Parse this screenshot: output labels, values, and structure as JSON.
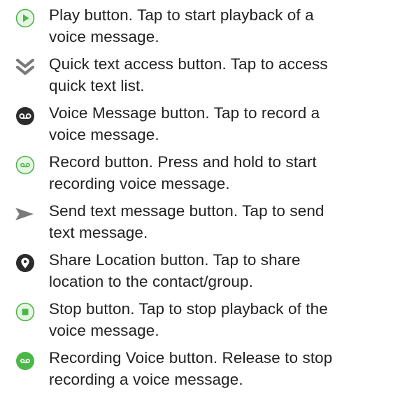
{
  "colors": {
    "accent_green": "#4ab847",
    "light_green_fill": "#e6f5e4",
    "dark_icon": "#2b2b2b",
    "gray_icon": "#7a7a7a",
    "text": "#222222"
  },
  "items": [
    {
      "icon": "play-icon",
      "line1": "Play button. Tap to start playback of a",
      "line2": "voice message."
    },
    {
      "icon": "double-chevron-down-icon",
      "line1": "Quick text access button. Tap to access",
      "line2": "quick text list."
    },
    {
      "icon": "voicemail-filled-icon",
      "line1": "Voice Message button. Tap to record a",
      "line2": "voice message."
    },
    {
      "icon": "record-icon",
      "line1": "Record button. Press and hold to start",
      "line2": "recording voice message."
    },
    {
      "icon": "send-arrow-icon",
      "line1": "Send text message button. Tap to send",
      "line2": "text message."
    },
    {
      "icon": "location-pin-icon",
      "line1": "Share Location button. Tap to share",
      "line2": "location to the contact/group."
    },
    {
      "icon": "stop-icon",
      "line1": "Stop button. Tap to stop playback of the",
      "line2": "voice message."
    },
    {
      "icon": "recording-voice-icon",
      "line1": "Recording Voice button. Release to stop",
      "line2": "recording a voice message."
    }
  ]
}
